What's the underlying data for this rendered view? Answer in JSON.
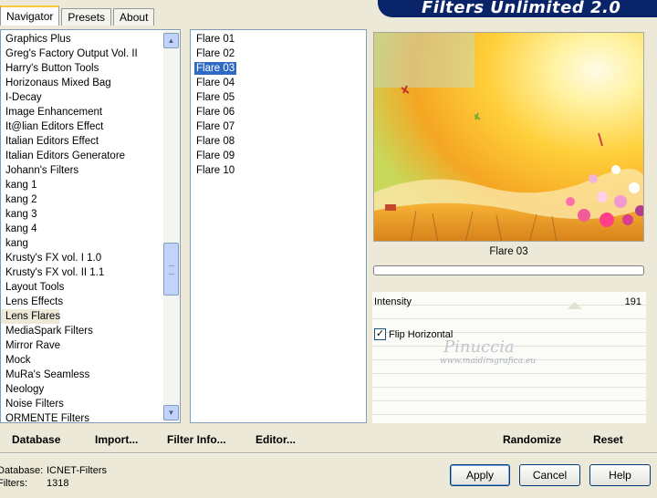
{
  "tabs": [
    {
      "label": "Navigator",
      "active": true
    },
    {
      "label": "Presets",
      "active": false
    },
    {
      "label": "About",
      "active": false
    }
  ],
  "app_title": "Filters Unlimited 2.0",
  "categories": [
    "Graphics Plus",
    "Greg's Factory Output Vol. II",
    "Harry's Button Tools",
    "Horizonaus Mixed Bag",
    "I-Decay",
    "Image Enhancement",
    "It@lian Editors Effect",
    "Italian Editors Effect",
    "Italian Editors Generatore",
    "Johann's Filters",
    "kang 1",
    "kang 2",
    "kang 3",
    "kang 4",
    "kang",
    "Krusty's FX vol. I 1.0",
    "Krusty's FX vol. II 1.1",
    "Layout Tools",
    "Lens Effects",
    "Lens Flares",
    "MediaSpark Filters",
    "Mirror Rave",
    "Mock",
    "MuRa's Seamless",
    "Neology",
    "Noise Filters",
    "ORMENTE Filters"
  ],
  "selected_category": "Lens Flares",
  "filters": [
    "Flare 01",
    "Flare 02",
    "Flare 03",
    "Flare 04",
    "Flare 05",
    "Flare 06",
    "Flare 07",
    "Flare 08",
    "Flare 09",
    "Flare 10"
  ],
  "selected_filter": "Flare 03",
  "preview": {
    "label": "Flare 03"
  },
  "params": {
    "intensity_label": "Intensity",
    "intensity_value": "191",
    "flip_label": "Flip Horizontal",
    "flip_checked": true
  },
  "links": {
    "database": "Database",
    "import": "Import...",
    "filter_info": "Filter Info...",
    "editor": "Editor...",
    "randomize": "Randomize",
    "reset": "Reset"
  },
  "info": {
    "database_label": "Database:",
    "database_value": "ICNET-Filters",
    "filters_label": "Filters:",
    "filters_value": "1318"
  },
  "buttons": {
    "apply": "Apply",
    "cancel": "Cancel",
    "help": "Help"
  },
  "watermark": {
    "name": "Pinuccia",
    "site": "www.maidirsgrafica.eu"
  },
  "colors": {
    "selection": "#316ac5",
    "banner": "#0a246a",
    "tab_highlight": "#ffc83c"
  }
}
